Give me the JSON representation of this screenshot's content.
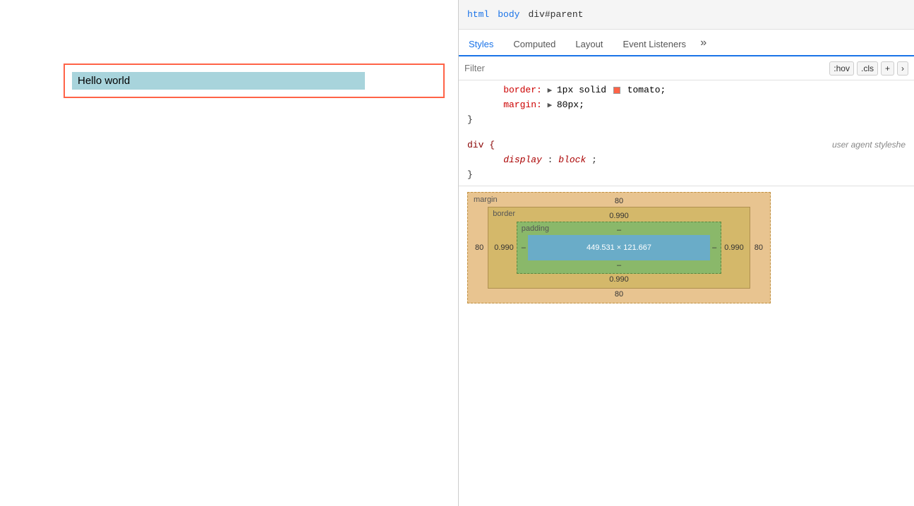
{
  "preview": {
    "hello_text": "Hello world"
  },
  "devtools": {
    "breadcrumb": {
      "items": [
        "html",
        "body",
        "div#parent"
      ]
    },
    "tabs": [
      {
        "label": "Styles",
        "active": true
      },
      {
        "label": "Computed",
        "active": false
      },
      {
        "label": "Layout",
        "active": false
      },
      {
        "label": "Event Listeners",
        "active": false
      },
      {
        "label": "»",
        "active": false
      }
    ],
    "filter": {
      "placeholder": "Filter",
      "hov_btn": ":hov",
      "cls_btn": ".cls",
      "add_btn": "+",
      "more_btn": "›"
    },
    "styles": {
      "rule1": {
        "selector": "",
        "properties": [
          {
            "name": "border:",
            "arrow": "▶",
            "value": "1px solid",
            "color": "tomato",
            "color_name": "tomato",
            "extra": ";"
          },
          {
            "name": "margin:",
            "arrow": "▶",
            "value": "80px",
            "extra": ";"
          }
        ],
        "open_brace": "",
        "close_brace": "}"
      },
      "rule2": {
        "selector": "div {",
        "source": "user agent styleshe",
        "properties": [
          {
            "name": "display:",
            "value": "block",
            "extra": ";"
          }
        ],
        "close_brace": "}"
      }
    },
    "box_model": {
      "margin_label": "margin",
      "margin_top": "80",
      "margin_bottom": "80",
      "margin_left": "80",
      "margin_right": "80",
      "border_label": "border",
      "border_top": "0.990",
      "border_bottom": "0.990",
      "border_left": "0.990",
      "border_right": "0.990",
      "padding_label": "padding",
      "padding_top": "–",
      "padding_bottom": "–",
      "padding_left": "–",
      "padding_right": "–",
      "content_label": "449.531 × 121.667"
    }
  }
}
